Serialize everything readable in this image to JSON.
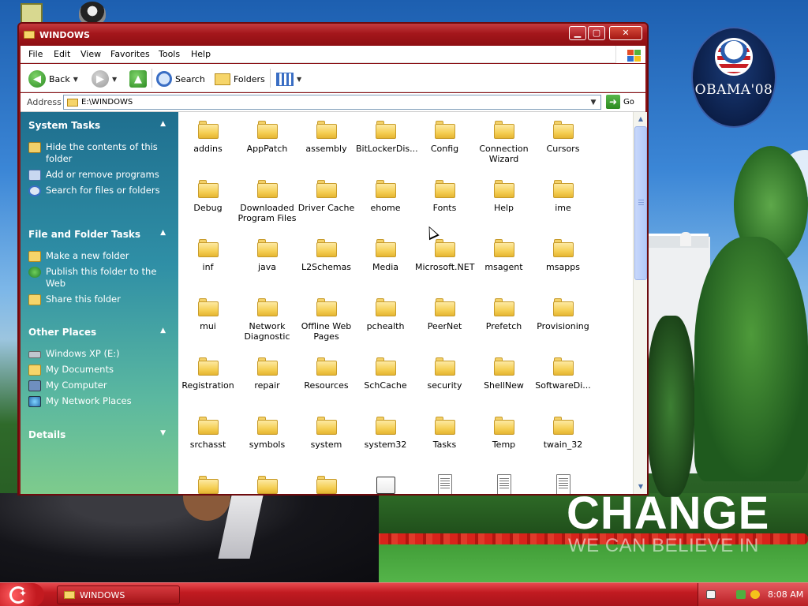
{
  "window": {
    "title": "WINDOWS",
    "controls": {
      "minimize": "▁",
      "maximize": "▢",
      "close": "✕"
    }
  },
  "menu": [
    "File",
    "Edit",
    "View",
    "Favorites",
    "Tools",
    "Help"
  ],
  "toolbar": {
    "back_label": "Back",
    "search_label": "Search",
    "folders_label": "Folders"
  },
  "address": {
    "label": "Address",
    "value": "E:\\WINDOWS",
    "go_label": "Go"
  },
  "taskpane": {
    "system_tasks": {
      "title": "System Tasks",
      "items": [
        {
          "label": "Hide the contents of this folder",
          "icon": "hide-contents-icon"
        },
        {
          "label": "Add or remove programs",
          "icon": "add-remove-programs-icon"
        },
        {
          "label": "Search for files or folders",
          "icon": "search-files-icon"
        }
      ]
    },
    "file_folder_tasks": {
      "title": "File and Folder Tasks",
      "items": [
        {
          "label": "Make a new folder",
          "icon": "new-folder-icon"
        },
        {
          "label": "Publish this folder to the Web",
          "icon": "globe-icon"
        },
        {
          "label": "Share this folder",
          "icon": "share-folder-icon"
        }
      ]
    },
    "other_places": {
      "title": "Other Places",
      "items": [
        {
          "label": "Windows XP (E:)",
          "icon": "drive-icon"
        },
        {
          "label": "My Documents",
          "icon": "my-documents-icon"
        },
        {
          "label": "My Computer",
          "icon": "my-computer-icon"
        },
        {
          "label": "My Network Places",
          "icon": "network-places-icon"
        }
      ]
    },
    "details": {
      "title": "Details"
    }
  },
  "files": [
    {
      "name": "addins",
      "type": "folder"
    },
    {
      "name": "AppPatch",
      "type": "folder"
    },
    {
      "name": "assembly",
      "type": "folder"
    },
    {
      "name": "BitLockerDis...",
      "type": "folder"
    },
    {
      "name": "Config",
      "type": "folder"
    },
    {
      "name": "Connection Wizard",
      "type": "folder"
    },
    {
      "name": "Cursors",
      "type": "folder"
    },
    {
      "name": "Debug",
      "type": "folder"
    },
    {
      "name": "Downloaded Program Files",
      "type": "folder"
    },
    {
      "name": "Driver Cache",
      "type": "folder"
    },
    {
      "name": "ehome",
      "type": "folder"
    },
    {
      "name": "Fonts",
      "type": "folder"
    },
    {
      "name": "Help",
      "type": "folder"
    },
    {
      "name": "ime",
      "type": "folder"
    },
    {
      "name": "inf",
      "type": "folder"
    },
    {
      "name": "java",
      "type": "folder"
    },
    {
      "name": "L2Schemas",
      "type": "folder"
    },
    {
      "name": "Media",
      "type": "folder"
    },
    {
      "name": "Microsoft.NET",
      "type": "folder"
    },
    {
      "name": "msagent",
      "type": "folder"
    },
    {
      "name": "msapps",
      "type": "folder"
    },
    {
      "name": "mui",
      "type": "folder"
    },
    {
      "name": "Network Diagnostic",
      "type": "folder"
    },
    {
      "name": "Offline Web Pages",
      "type": "folder"
    },
    {
      "name": "pchealth",
      "type": "folder"
    },
    {
      "name": "PeerNet",
      "type": "folder"
    },
    {
      "name": "Prefetch",
      "type": "folder"
    },
    {
      "name": "Provisioning",
      "type": "folder"
    },
    {
      "name": "Registration",
      "type": "folder"
    },
    {
      "name": "repair",
      "type": "folder"
    },
    {
      "name": "Resources",
      "type": "folder"
    },
    {
      "name": "SchCache",
      "type": "folder"
    },
    {
      "name": "security",
      "type": "folder"
    },
    {
      "name": "ShellNew",
      "type": "folder"
    },
    {
      "name": "SoftwareDi...",
      "type": "folder"
    },
    {
      "name": "srchasst",
      "type": "folder"
    },
    {
      "name": "symbols",
      "type": "folder"
    },
    {
      "name": "system",
      "type": "folder"
    },
    {
      "name": "system32",
      "type": "folder"
    },
    {
      "name": "Tasks",
      "type": "folder"
    },
    {
      "name": "Temp",
      "type": "folder"
    },
    {
      "name": "twain_32",
      "type": "folder"
    },
    {
      "name": "",
      "type": "folder"
    },
    {
      "name": "",
      "type": "folder"
    },
    {
      "name": "",
      "type": "folder"
    },
    {
      "name": "",
      "type": "msi"
    },
    {
      "name": "",
      "type": "file"
    },
    {
      "name": "",
      "type": "file"
    },
    {
      "name": "",
      "type": "file"
    }
  ],
  "desktop": {
    "badge_text": "OBAMA'08",
    "slogan_big": "CHANGE",
    "slogan_small": "WE CAN BELIEVE IN"
  },
  "taskbar": {
    "task_label": "WINDOWS",
    "clock": "8:08 AM"
  },
  "colors": {
    "titlebar": "#a3161b",
    "taskbar": "#c11b21",
    "taskpane_top": "#1f6f8f",
    "taskpane_bottom": "#7ecb8c"
  }
}
